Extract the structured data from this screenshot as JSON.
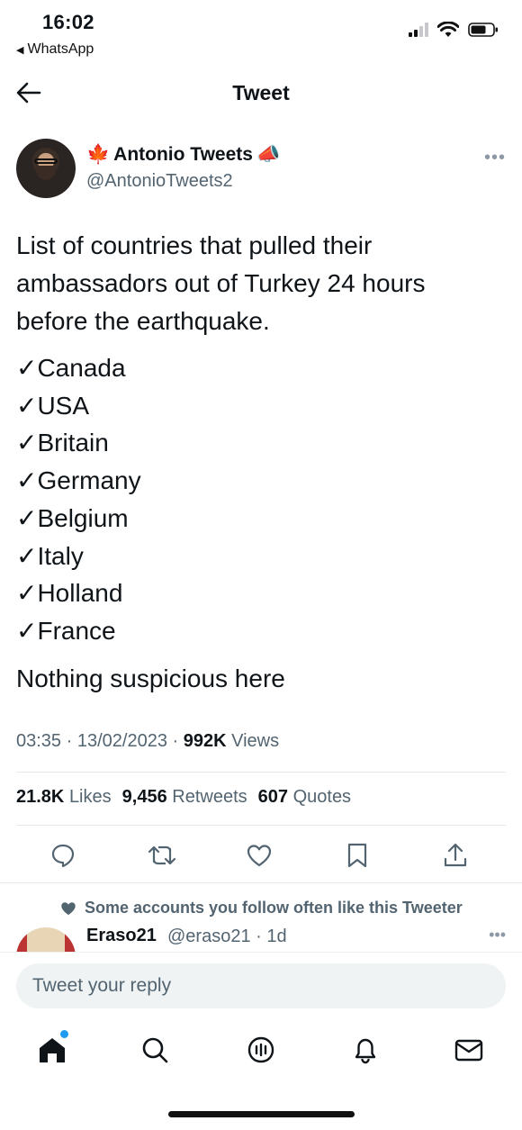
{
  "status_bar": {
    "time": "16:02",
    "back_app": "WhatsApp"
  },
  "nav": {
    "title": "Tweet"
  },
  "tweet": {
    "author": {
      "display_name": "Antonio Tweets",
      "handle": "@AntonioTweets2",
      "name_prefix_emoji": "🍁",
      "name_suffix_emoji": "📣"
    },
    "intro": "List of countries that pulled their ambassadors out of Turkey 24 hours before the earthquake.",
    "countries": [
      "✓Canada",
      "✓USA",
      "✓Britain",
      "✓Germany",
      "✓Belgium",
      "✓Italy",
      "✓Holland",
      "✓France"
    ],
    "closing": "Nothing suspicious here",
    "time": "03:35",
    "date": "13/02/2023",
    "views_count": "992K",
    "views_label": "Views",
    "likes_count": "21.8K",
    "likes_label": "Likes",
    "retweets_count": "9,456",
    "retweets_label": "Retweets",
    "quotes_count": "607",
    "quotes_label": "Quotes"
  },
  "social_context": {
    "text": "Some accounts you follow often like this Tweeter"
  },
  "reply_preview": {
    "name": "Eraso21",
    "handle_time": "@eraso21 · 1d"
  },
  "composer": {
    "placeholder": "Tweet your reply"
  },
  "colors": {
    "accent": "#1d9bf0",
    "secondary_text": "#536471",
    "primary_text": "#0f1419"
  },
  "icons": {
    "reply": "reply-icon",
    "retweet": "retweet-icon",
    "like": "heart-icon",
    "bookmark": "bookmark-icon",
    "share": "share-icon",
    "home": "home-icon",
    "search": "search-icon",
    "spaces": "spaces-icon",
    "notifications": "bell-icon",
    "messages": "mail-icon"
  }
}
